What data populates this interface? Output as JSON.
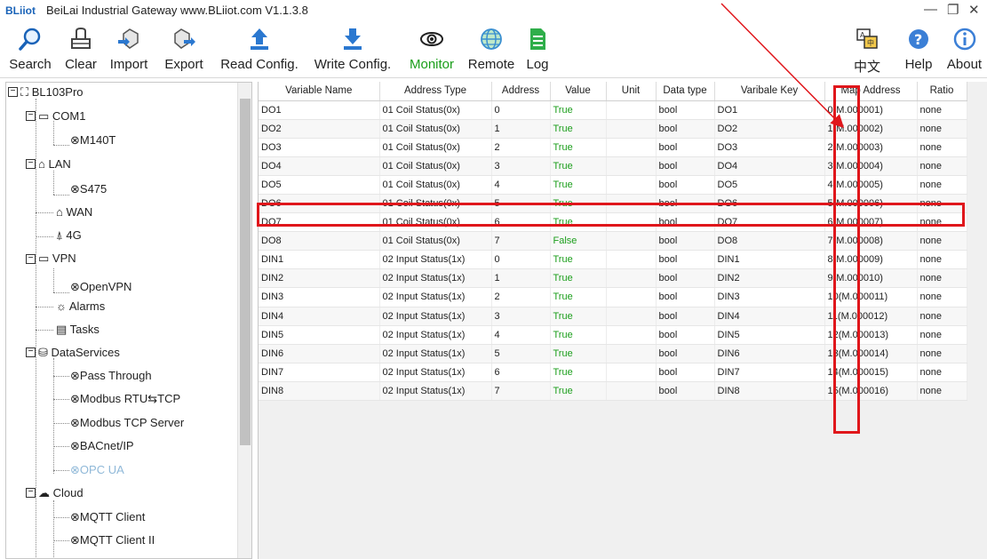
{
  "window": {
    "brand": "BLiiot",
    "title": "BeiLai Industrial Gateway www.BLiiot.com V1.1.3.8",
    "minimize_glyph": "—",
    "restore_glyph": "❐",
    "close_glyph": "✕"
  },
  "toolbar": {
    "search": "Search",
    "clear": "Clear",
    "import": "Import",
    "export": "Export",
    "read_config": "Read Config.",
    "write_config": "Write Config.",
    "monitor": "Monitor",
    "remote": "Remote",
    "log": "Log",
    "chinese": "中文",
    "help": "Help",
    "about": "About"
  },
  "tree": {
    "root": "BL103Pro",
    "com1": "COM1",
    "m140t": "M140T",
    "lan": "LAN",
    "s475": "S475",
    "wan": "WAN",
    "g4": "4G",
    "vpn": "VPN",
    "openvpn": "OpenVPN",
    "alarms": "Alarms",
    "tasks": "Tasks",
    "dataservices": "DataServices",
    "passthrough": "Pass Through",
    "modbus_rtu_tcp": "Modbus RTU⇆TCP",
    "modbus_tcp_server": "Modbus TCP Server",
    "bacnet": "BACnet/IP",
    "opcua": "OPC UA",
    "cloud": "Cloud",
    "mqtt1": "MQTT Client",
    "mqtt2": "MQTT Client II"
  },
  "table": {
    "headers": [
      "Variable Name",
      "Address Type",
      "Address",
      "Value",
      "Unit",
      "Data type",
      "Varibale Key",
      "Map Address",
      "Ratio"
    ],
    "rows": [
      [
        "DO1",
        "01 Coil Status(0x)",
        "0",
        "True",
        "",
        "bool",
        "DO1",
        "0(M.000001)",
        "none"
      ],
      [
        "DO2",
        "01 Coil Status(0x)",
        "1",
        "True",
        "",
        "bool",
        "DO2",
        "1(M.000002)",
        "none"
      ],
      [
        "DO3",
        "01 Coil Status(0x)",
        "2",
        "True",
        "",
        "bool",
        "DO3",
        "2(M.000003)",
        "none"
      ],
      [
        "DO4",
        "01 Coil Status(0x)",
        "3",
        "True",
        "",
        "bool",
        "DO4",
        "3(M.000004)",
        "none"
      ],
      [
        "DO5",
        "01 Coil Status(0x)",
        "4",
        "True",
        "",
        "bool",
        "DO5",
        "4(M.000005)",
        "none"
      ],
      [
        "DO6",
        "01 Coil Status(0x)",
        "5",
        "True",
        "",
        "bool",
        "DO6",
        "5(M.000006)",
        "none"
      ],
      [
        "DO7",
        "01 Coil Status(0x)",
        "6",
        "True",
        "",
        "bool",
        "DO7",
        "6(M.000007)",
        "none"
      ],
      [
        "DO8",
        "01 Coil Status(0x)",
        "7",
        "False",
        "",
        "bool",
        "DO8",
        "7(M.000008)",
        "none"
      ],
      [
        "DIN1",
        "02 Input Status(1x)",
        "0",
        "True",
        "",
        "bool",
        "DIN1",
        "8(M.000009)",
        "none"
      ],
      [
        "DIN2",
        "02 Input Status(1x)",
        "1",
        "True",
        "",
        "bool",
        "DIN2",
        "9(M.000010)",
        "none"
      ],
      [
        "DIN3",
        "02 Input Status(1x)",
        "2",
        "True",
        "",
        "bool",
        "DIN3",
        "10(M.000011)",
        "none"
      ],
      [
        "DIN4",
        "02 Input Status(1x)",
        "3",
        "True",
        "",
        "bool",
        "DIN4",
        "11(M.000012)",
        "none"
      ],
      [
        "DIN5",
        "02 Input Status(1x)",
        "4",
        "True",
        "",
        "bool",
        "DIN5",
        "12(M.000013)",
        "none"
      ],
      [
        "DIN6",
        "02 Input Status(1x)",
        "5",
        "True",
        "",
        "bool",
        "DIN6",
        "13(M.000014)",
        "none"
      ],
      [
        "DIN7",
        "02 Input Status(1x)",
        "6",
        "True",
        "",
        "bool",
        "DIN7",
        "14(M.000015)",
        "none"
      ],
      [
        "DIN8",
        "02 Input Status(1x)",
        "7",
        "True",
        "",
        "bool",
        "DIN8",
        "15(M.000016)",
        "none"
      ]
    ]
  },
  "colors": {
    "accent_blue": "#1a63b8",
    "value_green": "#1b9e1b",
    "annotation_red": "#e0161b"
  },
  "icons": [
    "search-icon",
    "clear-icon",
    "import-icon",
    "export-icon",
    "read-config-icon",
    "write-config-icon",
    "monitor-icon",
    "remote-icon",
    "log-icon",
    "language-icon",
    "help-icon",
    "about-icon"
  ]
}
